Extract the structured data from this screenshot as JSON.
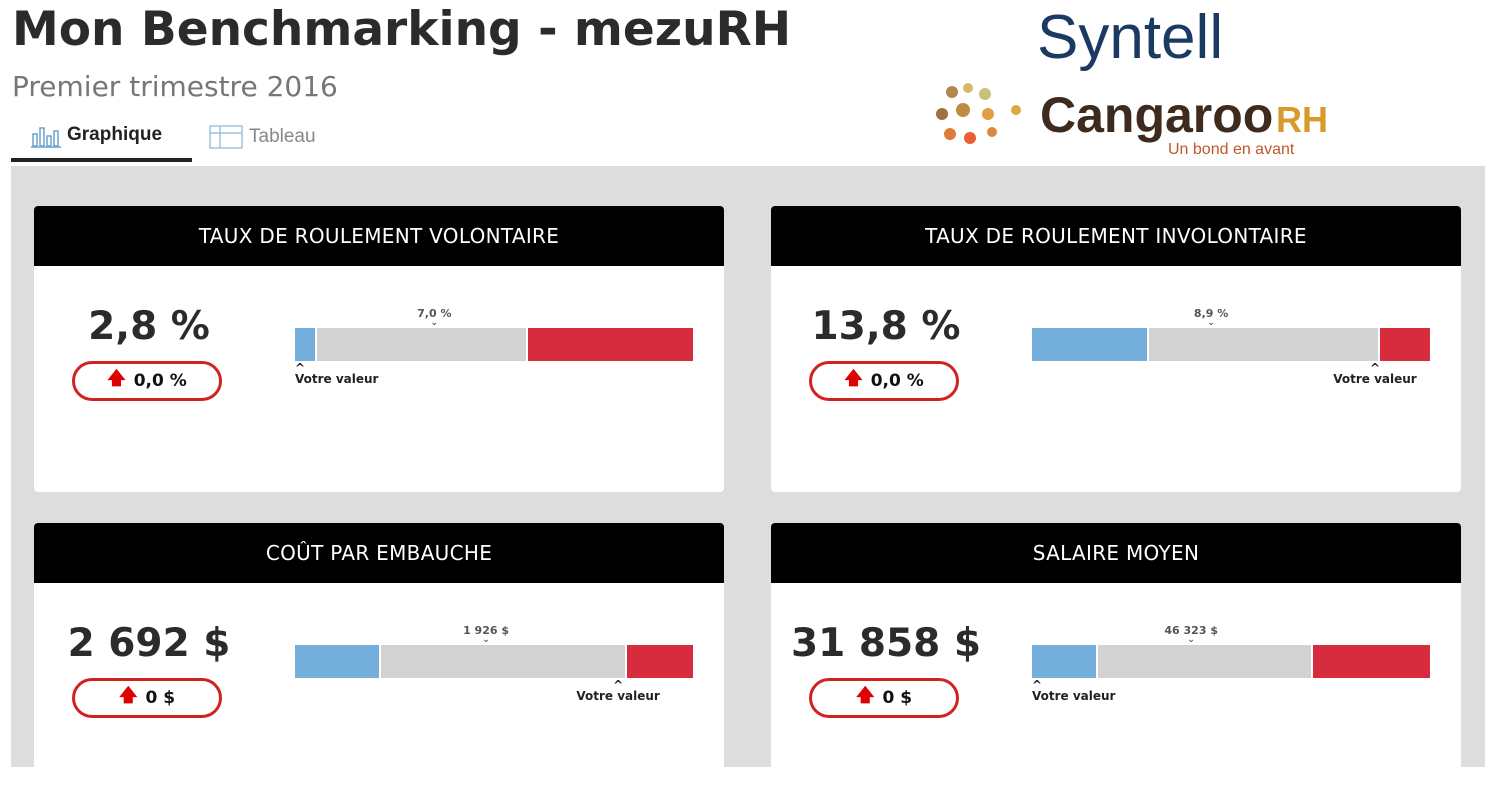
{
  "header": {
    "title": "Mon Benchmarking - mezuRH",
    "subtitle": "Premier trimestre 2016"
  },
  "tabs": [
    {
      "label": "Graphique",
      "icon": "bar-chart-icon",
      "active": true
    },
    {
      "label": "Tableau",
      "icon": "table-icon",
      "active": false
    }
  ],
  "logos": {
    "syntell": "Syntell",
    "cangaroo": "Cangaroo",
    "cangaroo_rh": "RH",
    "cangaroo_tagline": "Un bond en avant"
  },
  "colors": {
    "blue_segment": "#74aedb",
    "gray_segment": "#d2d2d2",
    "red_segment": "#d72c3d",
    "pill_border": "#d0231f",
    "arrow": "#e00000"
  },
  "marker_label": "Votre valeur",
  "cards": [
    {
      "title": "TAUX DE ROULEMENT VOLONTAIRE",
      "value": "2,8 %",
      "delta": "0,0 %",
      "delta_icon": "arrow-up-icon",
      "average_label": "7,0 %",
      "segments": [
        0.05,
        0.53,
        0.42
      ],
      "average_pos": 0.35,
      "marker_pos": 0.0
    },
    {
      "title": "TAUX DE ROULEMENT INVOLONTAIRE",
      "value": "13,8 %",
      "delta": "0,0 %",
      "delta_icon": "arrow-up-icon",
      "average_label": "8,9 %",
      "segments": [
        0.29,
        0.58,
        0.13
      ],
      "average_pos": 0.45,
      "marker_pos": 0.87
    },
    {
      "title": "COÛT PAR EMBAUCHE",
      "value": "2 692 $",
      "delta": "0 $",
      "delta_icon": "arrow-up-icon",
      "average_label": "1 926 $",
      "segments": [
        0.21,
        0.62,
        0.17
      ],
      "average_pos": 0.48,
      "marker_pos": 0.82
    },
    {
      "title": "SALAIRE MOYEN",
      "value": "31 858 $",
      "delta": "0 $",
      "delta_icon": "arrow-up-icon",
      "average_label": "46 323 $",
      "segments": [
        0.16,
        0.54,
        0.3
      ],
      "average_pos": 0.4,
      "marker_pos": 0.0
    }
  ]
}
